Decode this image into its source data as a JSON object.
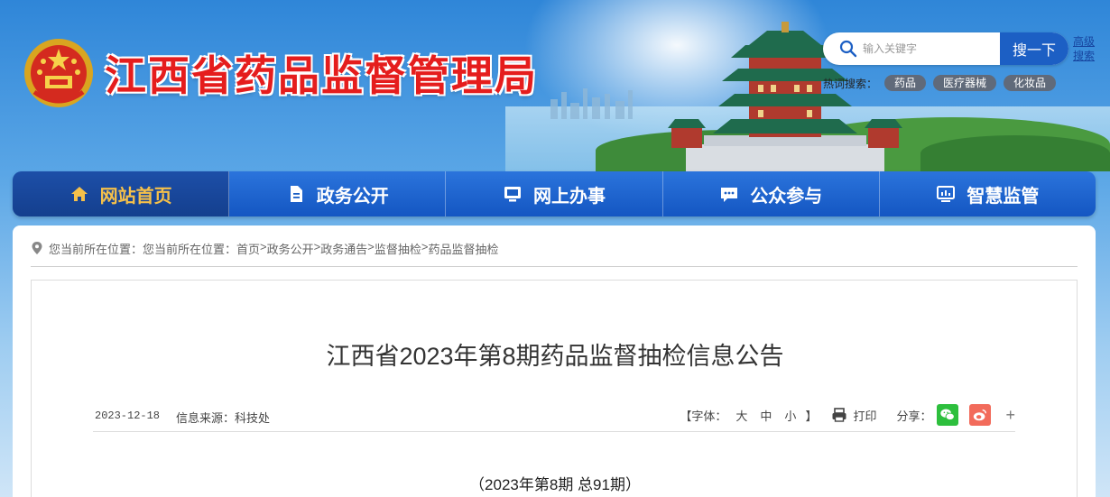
{
  "site": {
    "title": "江西省药品监督管理局",
    "search": {
      "placeholder": "输入关键字",
      "button_label": "搜一下",
      "advanced_label": "高级搜索"
    },
    "hot_search": {
      "label": "热词搜索：",
      "tags": [
        "药品",
        "医疗器械",
        "化妆品"
      ]
    }
  },
  "nav": {
    "items": [
      {
        "label": "网站首页",
        "icon": "home-icon",
        "active": true
      },
      {
        "label": "政务公开",
        "icon": "document-icon",
        "active": false
      },
      {
        "label": "网上办事",
        "icon": "monitor-icon",
        "active": false
      },
      {
        "label": "公众参与",
        "icon": "chat-icon",
        "active": false
      },
      {
        "label": "智慧监管",
        "icon": "dashboard-icon",
        "active": false
      }
    ]
  },
  "breadcrumb": {
    "prefix": "您当前所在位置：您当前所在位置：",
    "items": [
      "首页",
      "政务公开",
      "政务通告",
      "监督抽检",
      "药品监督抽检"
    ],
    "separator": ">"
  },
  "article": {
    "title": "江西省2023年第8期药品监督抽检信息公告",
    "date": "2023-12-18",
    "source": "信息来源：科技处",
    "font_size": {
      "open": "【字体：",
      "large": "大",
      "medium": "中",
      "small": "小",
      "close": "】"
    },
    "print_label": "打印",
    "share_label": "分享：",
    "share_more": "+",
    "issue": "（2023年第8期 总91期）"
  },
  "colors": {
    "brand_red": "#e51d1d",
    "nav_blue": "#1c5fc4",
    "nav_active_text": "#f5c04a",
    "wechat_green": "#2dbf3d",
    "weibo_red": "#f26b5b"
  }
}
